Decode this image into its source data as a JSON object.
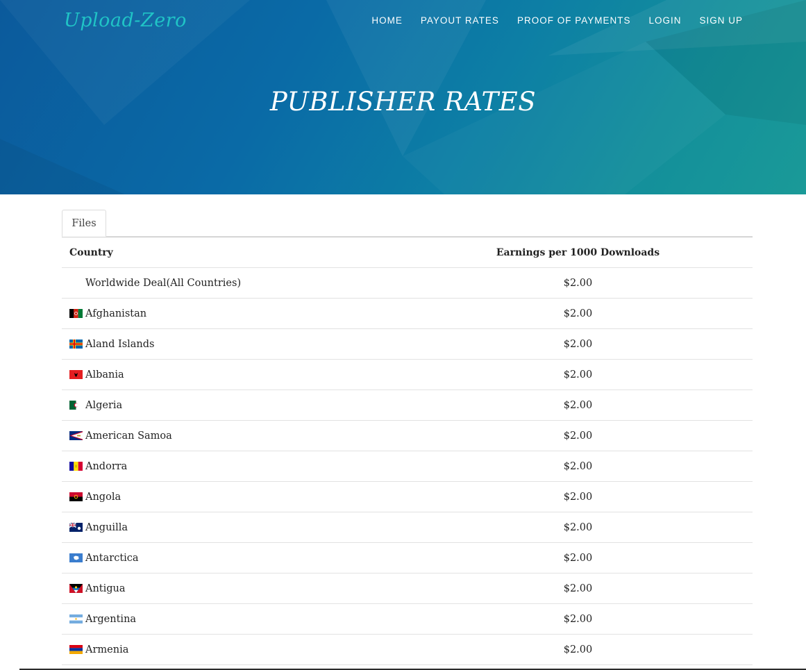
{
  "header": {
    "logo": "Upload-Zero",
    "nav": [
      "HOME",
      "PAYOUT RATES",
      "PROOF OF PAYMENTS",
      "LOGIN",
      "SIGN UP"
    ]
  },
  "hero": {
    "title": "PUBLISHER RATES"
  },
  "tabs": [
    {
      "label": "Files",
      "active": true
    }
  ],
  "table": {
    "headers": [
      "Country",
      "Earnings per 1000 Downloads"
    ],
    "rows": [
      {
        "country": "Worldwide Deal(All Countries)",
        "rate": "$2.00",
        "flag": "none"
      },
      {
        "country": "Afghanistan",
        "rate": "$2.00",
        "flag": "afghanistan-flag-icon"
      },
      {
        "country": "Aland Islands",
        "rate": "$2.00",
        "flag": "aland-islands-flag-icon"
      },
      {
        "country": "Albania",
        "rate": "$2.00",
        "flag": "albania-flag-icon"
      },
      {
        "country": "Algeria",
        "rate": "$2.00",
        "flag": "algeria-flag-icon"
      },
      {
        "country": "American Samoa",
        "rate": "$2.00",
        "flag": "american-samoa-flag-icon"
      },
      {
        "country": "Andorra",
        "rate": "$2.00",
        "flag": "andorra-flag-icon"
      },
      {
        "country": "Angola",
        "rate": "$2.00",
        "flag": "angola-flag-icon"
      },
      {
        "country": "Anguilla",
        "rate": "$2.00",
        "flag": "anguilla-flag-icon"
      },
      {
        "country": "Antarctica",
        "rate": "$2.00",
        "flag": "antarctica-flag-icon"
      },
      {
        "country": "Antigua",
        "rate": "$2.00",
        "flag": "antigua-flag-icon"
      },
      {
        "country": "Argentina",
        "rate": "$2.00",
        "flag": "argentina-flag-icon"
      },
      {
        "country": "Armenia",
        "rate": "$2.00",
        "flag": "armenia-flag-icon"
      }
    ]
  },
  "colors": {
    "logo": "#20c4c6",
    "hero_start": "#0b5a9c",
    "hero_end": "#1a9a98"
  }
}
